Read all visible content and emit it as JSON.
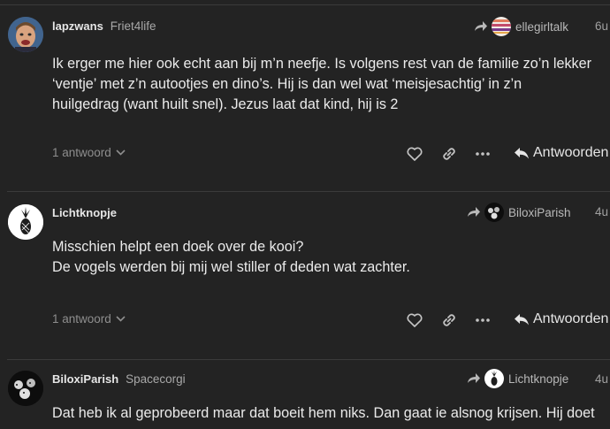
{
  "posts": [
    {
      "author": "lapzwans",
      "flair": "Friet4life",
      "reply_to": "ellegirltalk",
      "time": "6u",
      "body": [
        "Ik erger me hier ook echt aan bij m’n neefje. Is volgens rest van de familie zo’n lekker ‘ventje’ met z’n autootjes en dino’s. Hij is dan wel wat ‘meisjesachtig’ in z’n huilgedrag (want huilt snel). Jezus laat dat kind, hij is 2"
      ],
      "replies": "1 antwoord",
      "reply_label": "Antwoorden"
    },
    {
      "author": "Lichtknopje",
      "flair": "",
      "reply_to": "BiloxiParish",
      "time": "4u",
      "body": [
        "Misschien helpt een doek over de kooi?",
        "De vogels werden bij mij wel stiller of deden wat zachter."
      ],
      "replies": "1 antwoord",
      "reply_label": "Antwoorden"
    },
    {
      "author": "BiloxiParish",
      "flair": "Spacecorgi",
      "reply_to": "Lichtknopje",
      "time": "4u",
      "body": [
        "Dat heb ik al geprobeerd maar dat boeit hem niks. Dan gaat ie alsnog krijsen. Hij doet"
      ],
      "replies": "",
      "reply_label": ""
    }
  ],
  "icons": {
    "like": "heart-icon",
    "share": "link-icon",
    "more": "ellipsis-icon",
    "reply": "reply-arrow-icon",
    "reply_to": "share-arrow-icon"
  },
  "colors": {
    "background": "#232323",
    "text": "#ebebeb",
    "muted": "#8e8e8e",
    "divider": "#3b3b3b"
  }
}
